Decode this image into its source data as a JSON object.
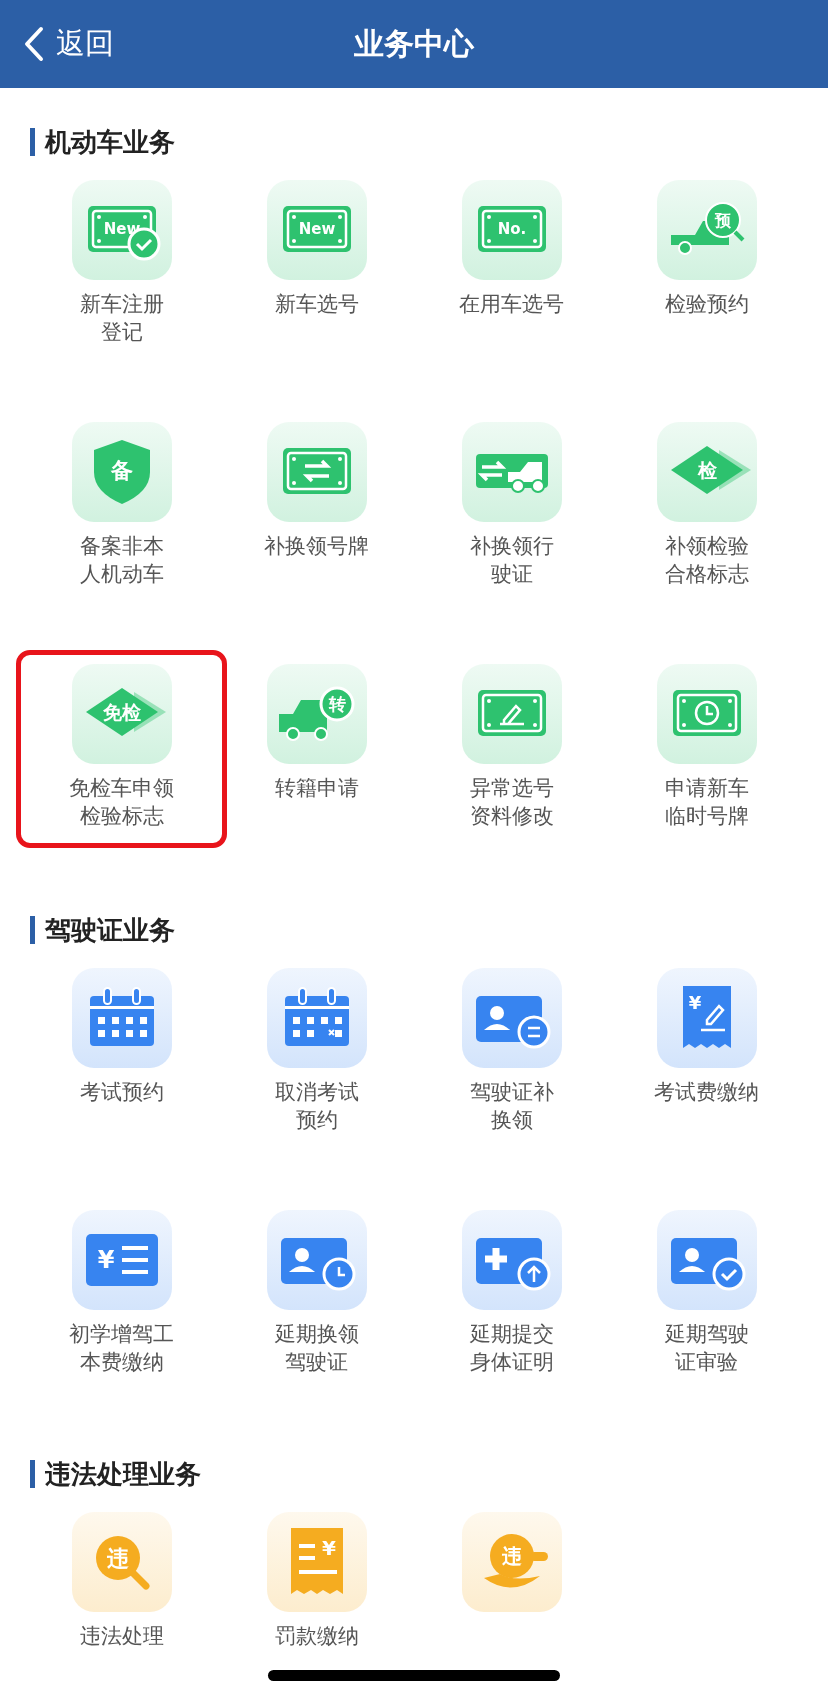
{
  "header": {
    "back_label": "返回",
    "title": "业务中心"
  },
  "sections": [
    {
      "title": "机动车业务",
      "color": "#2ec26f",
      "items": [
        {
          "label_lines": [
            "新车注册",
            "登记"
          ],
          "kind": "plate-check",
          "icon_text": "New",
          "highlighted": false
        },
        {
          "label_lines": [
            "新车选号"
          ],
          "kind": "plate",
          "icon_text": "New",
          "highlighted": false
        },
        {
          "label_lines": [
            "在用车选号"
          ],
          "kind": "plate",
          "icon_text": "No.",
          "highlighted": false
        },
        {
          "label_lines": [
            "检验预约"
          ],
          "kind": "truck-search",
          "icon_text": "预",
          "highlighted": false
        },
        {
          "label_lines": [
            "备案非本",
            "人机动车"
          ],
          "kind": "shield",
          "icon_text": "备",
          "highlighted": false
        },
        {
          "label_lines": [
            "补换领号牌"
          ],
          "kind": "plate-swap",
          "highlighted": false
        },
        {
          "label_lines": [
            "补换领行",
            "驶证"
          ],
          "kind": "car-swap",
          "highlighted": false
        },
        {
          "label_lines": [
            "补领检验",
            "合格标志"
          ],
          "kind": "diamond",
          "icon_text": "检",
          "highlighted": false
        },
        {
          "label_lines": [
            "免检车申领",
            "检验标志"
          ],
          "kind": "diamond",
          "icon_text": "免检",
          "highlighted": true
        },
        {
          "label_lines": [
            "转籍申请"
          ],
          "kind": "truck-circle",
          "icon_text": "转",
          "highlighted": false
        },
        {
          "label_lines": [
            "异常选号",
            "资料修改"
          ],
          "kind": "plate-edit",
          "highlighted": false
        },
        {
          "label_lines": [
            "申请新车",
            "临时号牌"
          ],
          "kind": "plate-clock",
          "highlighted": false
        }
      ]
    },
    {
      "title": "驾驶证业务",
      "color": "#3784f0",
      "items": [
        {
          "label_lines": [
            "考试预约"
          ],
          "kind": "calendar",
          "highlighted": false
        },
        {
          "label_lines": [
            "取消考试",
            "预约"
          ],
          "kind": "calendar-x",
          "highlighted": false
        },
        {
          "label_lines": [
            "驾驶证补",
            "换领"
          ],
          "kind": "id-swap",
          "highlighted": false
        },
        {
          "label_lines": [
            "考试费缴纳"
          ],
          "kind": "receipt-edit",
          "icon_text": "¥",
          "highlighted": false
        },
        {
          "label_lines": [
            "初学增驾工",
            "本费缴纳"
          ],
          "kind": "yen-list",
          "icon_text": "¥",
          "highlighted": false
        },
        {
          "label_lines": [
            "延期换领",
            "驾驶证"
          ],
          "kind": "id-clock",
          "highlighted": false
        },
        {
          "label_lines": [
            "延期提交",
            "身体证明"
          ],
          "kind": "plus-up",
          "highlighted": false
        },
        {
          "label_lines": [
            "延期驾驶",
            "证审验"
          ],
          "kind": "id-check",
          "highlighted": false
        }
      ]
    },
    {
      "title": "违法处理业务",
      "color": "#f5ac20",
      "items": [
        {
          "label_lines": [
            "违法处理"
          ],
          "kind": "search-circle",
          "icon_text": "违",
          "highlighted": false
        },
        {
          "label_lines": [
            "罚款缴纳"
          ],
          "kind": "receipt-yen",
          "icon_text": "¥",
          "highlighted": false
        },
        {
          "kind": "hand-coin",
          "icon_text": "违",
          "highlighted": false
        }
      ]
    }
  ]
}
